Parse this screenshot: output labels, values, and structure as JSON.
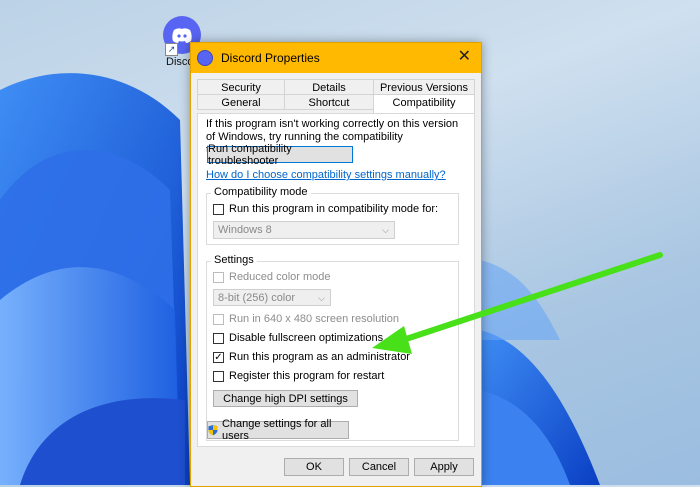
{
  "desktop": {
    "icon_label": "Disco"
  },
  "dialog": {
    "title": "Discord Properties",
    "tabs_row1": [
      "Security",
      "Details",
      "Previous Versions"
    ],
    "tabs_row2": [
      "General",
      "Shortcut",
      "Compatibility"
    ],
    "active_tab": "Compatibility",
    "intro_text": "If this program isn't working correctly on this version of Windows, try running the compatibility troubleshooter.",
    "troubleshooter_button": "Run compatibility troubleshooter",
    "manual_link": "How do I choose compatibility settings manually?",
    "compat_mode": {
      "title": "Compatibility mode",
      "checkbox_label": "Run this program in compatibility mode for:",
      "checked": false,
      "os_select": "Windows 8"
    },
    "settings": {
      "title": "Settings",
      "reduced_color": {
        "label": "Reduced color mode",
        "checked": false,
        "enabled": false
      },
      "color_select": "8-bit (256) color",
      "res_640": {
        "label": "Run in 640 x 480 screen resolution",
        "checked": false,
        "enabled": false
      },
      "disable_fullscreen": {
        "label": "Disable fullscreen optimizations",
        "checked": false
      },
      "run_as_admin": {
        "label": "Run this program as an administrator",
        "checked": true
      },
      "register_restart": {
        "label": "Register this program for restart",
        "checked": false
      },
      "dpi_button": "Change high DPI settings"
    },
    "all_users_button": "Change settings for all users",
    "ok_label": "OK",
    "cancel_label": "Cancel",
    "apply_label": "Apply"
  },
  "colors": {
    "titlebar": "#ffb900",
    "arrow": "#48e018",
    "link": "#0066cc",
    "discord": "#5865f2"
  }
}
